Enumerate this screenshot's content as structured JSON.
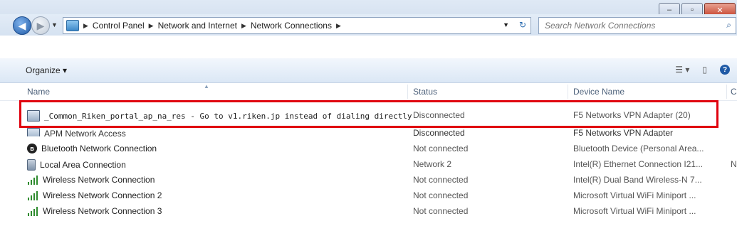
{
  "window": {
    "controls": {
      "minimize": "–",
      "maximize": "▫",
      "close": "✕"
    }
  },
  "nav": {
    "back_icon": "◀",
    "forward_icon": "▶",
    "breadcrumb": [
      "Control Panel",
      "Network and Internet",
      "Network Connections"
    ],
    "search_placeholder": "Search Network Connections"
  },
  "toolbar": {
    "organize_label": "Organize ▾",
    "view_icon": "☰ ▾",
    "pane_icon": "▯",
    "help_icon": "?"
  },
  "columns": {
    "name": "Name",
    "status": "Status",
    "device": "Device Name",
    "extra": "C"
  },
  "rows": [
    {
      "name": "_Common_Riken_portal_ap_na_res - Go to v1.riken.jp instead of dialing directly",
      "status": "Disconnected",
      "device": "F5 Networks VPN Adapter (20)",
      "icon": "vpn-icon"
    },
    {
      "name": "APM Network Access",
      "status": "Disconnected",
      "device": "F5 Networks VPN Adapter",
      "icon": "vpn-icon"
    },
    {
      "name": "Bluetooth Network Connection",
      "status": "Not connected",
      "device": "Bluetooth Device (Personal Area...",
      "icon": "bluetooth-icon"
    },
    {
      "name": "Local Area Connection",
      "status": "Network 2",
      "device": "Intel(R) Ethernet Connection I21...",
      "extra": "N",
      "icon": "ethernet-icon"
    },
    {
      "name": "Wireless Network Connection",
      "status": "Not connected",
      "device": "Intel(R) Dual Band Wireless-N 7...",
      "icon": "wifi-icon"
    },
    {
      "name": "Wireless Network Connection 2",
      "status": "Not connected",
      "device": "Microsoft Virtual WiFi Miniport ...",
      "icon": "wifi-icon"
    },
    {
      "name": "Wireless Network Connection 3",
      "status": "Not connected",
      "device": "Microsoft Virtual WiFi Miniport ...",
      "icon": "wifi-icon"
    }
  ],
  "colors": {
    "highlight": "#e0000e",
    "title_bar": "#d5e2f1"
  }
}
